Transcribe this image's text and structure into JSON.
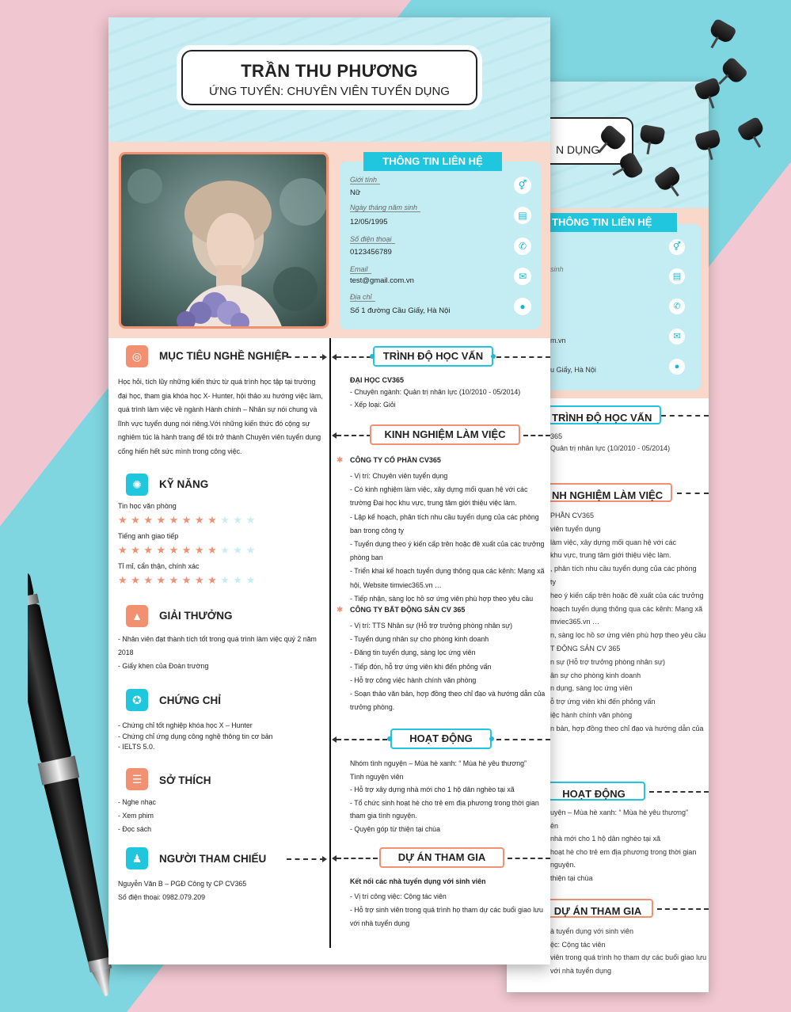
{
  "resume": {
    "name": "TRẦN THU PHƯƠNG",
    "position": "ỨNG TUYỂN: CHUYÊN VIÊN TUYỂN DỤNG",
    "contact": {
      "title": "THÔNG TIN LIÊN HỆ",
      "items": [
        {
          "label": "Giới tính",
          "value": "Nữ",
          "icon": "gender-icon"
        },
        {
          "label": "Ngày tháng năm sinh",
          "value": "12/05/1995",
          "icon": "birthday-cake-icon"
        },
        {
          "label": "Số điện thoại",
          "value": "0123456789",
          "icon": "phone-icon"
        },
        {
          "label": "Email",
          "value": "test@gmail.com.vn",
          "icon": "email-icon"
        },
        {
          "label": "Địa chỉ",
          "value": "Số 1 đường Cầu Giấy, Hà Nội",
          "icon": "location-icon"
        }
      ]
    },
    "objective": {
      "title": "MỤC TIÊU NGHỀ NGHIỆP",
      "lines": [
        "Học hỏi, tích lũy những kiến thức từ quá trình học tập tại trường",
        "đại học, tham gia khóa học X- Hunter, hội thảo xu hướng việc làm,",
        "quá trình làm việc về ngành Hành chính – Nhân sự nói chung và",
        "lĩnh vực tuyển dụng nói riêng.Với những kiến thức đó cộng sự",
        "nghiêm túc là hành trang để tôi trở thành Chuyên viên tuyển dụng",
        "cống hiến hết sức mình trong công việc."
      ]
    },
    "skills": {
      "title": "KỸ NĂNG",
      "items": [
        {
          "name": "Tin học văn phòng",
          "rating": 8,
          "max": 11
        },
        {
          "name": "Tiếng anh giao tiếp",
          "rating": 8,
          "max": 11
        },
        {
          "name": "Tỉ mỉ, cẩn thận, chính xác",
          "rating": 8,
          "max": 11
        }
      ]
    },
    "awards": {
      "title": "GIẢI THƯỞNG",
      "lines": [
        "- Nhân viên đạt thành tích tốt trong quá trình làm việc quý 2 năm",
        "2018",
        "- Giấy khen của Đoàn trường"
      ]
    },
    "certificates": {
      "title": "CHỨNG CHỈ",
      "lines": [
        "- Chứng chỉ tốt nghiệp khóa học X – Hunter",
        "- Chứng chỉ ứng dụng công nghệ thông tin cơ bản",
        "- IELTS 5.0."
      ]
    },
    "hobbies": {
      "title": "SỞ THÍCH",
      "lines": [
        "- Nghe nhạc",
        "- Xem phim",
        "- Đọc sách"
      ]
    },
    "references": {
      "title": "NGƯỜI THAM CHIẾU",
      "lines": [
        "Nguyễn Văn B – PGĐ Công ty CP CV365",
        "Số điện thoại: 0982.079.209"
      ]
    },
    "education": {
      "title": "TRÌNH ĐỘ HỌC VẤN",
      "school": "ĐẠI HỌC CV365",
      "lines": [
        "- Chuyên ngành: Quản trị nhân lực (10/2010 - 05/2014)",
        "- Xếp loại: Giỏi"
      ]
    },
    "experience": {
      "title": "KINH NGHIỆM LÀM VIỆC",
      "jobs": [
        {
          "company": "CÔNG TY CỔ PHẦN CV365",
          "lines": [
            "- Vị trí: Chuyên viên tuyển dụng",
            "- Có kinh nghiệm làm việc, xây dựng mối quan hệ với các",
            "trường Đại học khu vực, trung tâm giới thiệu việc làm.",
            "- Lập kế hoạch, phân tích nhu cầu tuyển dụng của các phòng",
            "ban trong công ty",
            "- Tuyển dụng theo ý kiến cấp trên hoặc đề xuất của các trưởng",
            "phòng ban",
            "- Triển khai kế hoạch tuyển dụng thông qua các kênh: Mạng xã",
            "hội, Website timviec365.vn …",
            "- Tiếp nhận, sàng lọc hồ sơ ứng viên phù hợp theo yêu cầu"
          ]
        },
        {
          "company": "CÔNG TY BẤT ĐỘNG SẢN CV 365",
          "lines": [
            "- Vị trí: TTS Nhân sự (Hỗ trợ trưởng phòng nhân sự)",
            "- Tuyển dụng nhân sự cho phòng kinh doanh",
            "- Đăng tin tuyển dụng, sàng lọc ứng viên",
            "- Tiếp đón, hỗ trợ ứng viên khi đến phỏng vấn",
            "- Hỗ trợ công việc hành chính văn phòng",
            "- Soạn thảo văn bản, hợp đồng theo chỉ đạo và hướng dẫn của",
            "trưởng phòng."
          ]
        }
      ]
    },
    "activities": {
      "title": "HOẠT ĐỘNG",
      "lines": [
        "Nhóm tình nguyện – Mùa hè xanh: “ Mùa hè yêu thương”",
        "Tình nguyện viên",
        "- Hỗ trợ xây dựng nhà mới cho 1 hộ dân nghèo tại xã",
        "- Tổ chức sinh hoạt hè cho trẻ em địa phương trong thời gian",
        "tham gia tình nguyện.",
        "- Quyên góp từ thiện tại chùa"
      ]
    },
    "projects": {
      "title": "DỰ ÁN THAM GIA",
      "name": "Kết nối các nhà tuyển dụng với sinh viên",
      "lines": [
        "- Vị trí công việc: Cộng tác viên",
        "- Hỗ trợ sinh viên trong quá trình họ tham dự các buổi giao lưu",
        "với nhà tuyển dụng"
      ]
    }
  },
  "back_sheet": {
    "position_fragment": "N DỤNG",
    "contact_title": "THÔNG TIN LIÊN HỆ",
    "fragments": [
      "sinh",
      "m.vn",
      "u Giấy, Hà Nội"
    ],
    "education_title": "TRÌNH ĐỘ HỌC VẤN",
    "education_lines": [
      "365",
      "Quản trị nhân lực (10/2010 - 05/2014)"
    ],
    "experience_title": "NH NGHIỆM LÀM VIỆC",
    "experience_lines": [
      "PHẦN CV365",
      "viên tuyển dụng",
      "làm việc, xây dựng mối quan hệ với các",
      "khu vực, trung tâm giới thiệu việc làm.",
      ", phân tích nhu cầu tuyển dụng của các phòng",
      "ty",
      "heo ý kiến cấp trên hoặc đề xuất của các trưởng",
      "hoạch tuyển dụng thông qua các kênh: Mạng xã",
      "mviec365.vn …",
      "n, sàng lọc hồ sơ ứng viên phù hợp theo yêu cầu",
      "T ĐỘNG SẢN CV 365",
      "n sự (Hỗ trợ trưởng phòng nhân sự)",
      "ân sự cho phòng kinh doanh",
      "n dụng, sàng lọc ứng viên",
      "ỗ trợ ứng viên khi đến phỏng vấn",
      "iệc hành chính văn phòng",
      "n bản, hợp đồng theo chỉ đạo và hướng dẫn của"
    ],
    "activities_title": "HOẠT ĐỘNG",
    "activities_lines": [
      "uyện – Mùa hè xanh: “ Mùa hè yêu thương”",
      "ên",
      "nhà mới cho 1 hộ dân nghèo tại xã",
      "hoạt hè cho trẻ em địa phương trong thời gian",
      "nguyện.",
      "thiện tại chùa"
    ],
    "projects_title": "DỰ ÁN THAM GIA",
    "projects_lines": [
      "à tuyển dụng với sinh viên",
      "ệc: Cộng tác viên",
      "viên trong quá trình họ tham dự các buổi giao lưu",
      "với nhà tuyển dụng"
    ]
  },
  "colors": {
    "accent_cyan": "#1fc6dd",
    "accent_salmon": "#f29072",
    "band_pink": "#f9d9cb",
    "panel_blue": "#c3ecf3"
  }
}
